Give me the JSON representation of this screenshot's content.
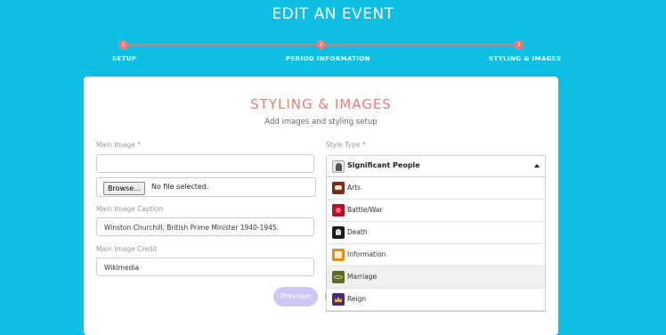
{
  "header": {
    "title": "EDIT AN EVENT"
  },
  "stepper": {
    "steps": [
      {
        "number": "1",
        "label": "SETUP"
      },
      {
        "number": "2",
        "label": "PERIOD INFORMATION"
      },
      {
        "number": "3",
        "label": "STYLING & IMAGES"
      }
    ]
  },
  "card": {
    "title": "STYLING & IMAGES",
    "subtitle": "Add images and styling setup"
  },
  "form": {
    "main_image_label": "Main Image *",
    "main_image_value": "",
    "browse_label": "Browse...",
    "no_file_text": "No file selected.",
    "caption_label": "Main Image Caption",
    "caption_value": "Winston Churchill, British Prime Minister 1940-1945.",
    "credit_label": "Main Image Credit",
    "credit_value": "Wikimedia",
    "previous_label": "Previous",
    "style_type_label": "Style Type *",
    "style_type_selected": "Significant People",
    "style_type_selected_icon": "portrait-icon",
    "style_options": [
      {
        "label": "Arts",
        "icon": "theatre-masks-icon"
      },
      {
        "label": "Battle/War",
        "icon": "explosion-icon"
      },
      {
        "label": "Death",
        "icon": "skull-icon"
      },
      {
        "label": "Information",
        "icon": "book-icon"
      },
      {
        "label": "Marriage",
        "icon": "rings-icon"
      },
      {
        "label": "Reign",
        "icon": "crown-icon"
      }
    ]
  },
  "colors": {
    "background": "#0fbee3",
    "accent": "#ef7b77",
    "previous_button": "#cfc8f5"
  }
}
